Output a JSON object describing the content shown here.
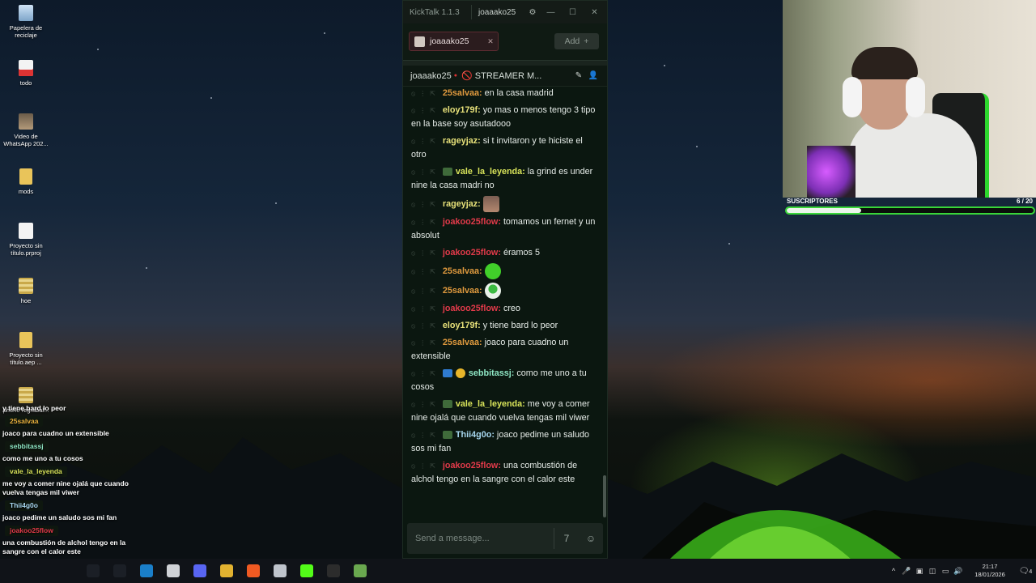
{
  "desktop": {
    "icons": [
      {
        "label": "Papelera de reciclaje",
        "icon": "recycle-bin-icon"
      },
      {
        "label": "todo",
        "icon": "document-icon"
      },
      {
        "label": "Video de WhatsApp 202...",
        "icon": "video-file-icon"
      },
      {
        "label": "mods",
        "icon": "folder-icon"
      },
      {
        "label": "Proyecto sin título.prproj",
        "icon": "document-icon"
      },
      {
        "label": "hoe",
        "icon": "archive-icon"
      },
      {
        "label": "Proyecto sin título.aep ...",
        "icon": "folder-icon"
      },
      {
        "label": "phone regrabal...",
        "icon": "archive-icon"
      }
    ]
  },
  "kicktalk": {
    "app_title": "KickTalk 1.1.3",
    "user": "joaaako25",
    "tab": {
      "label": "joaaako25",
      "close": "✕"
    },
    "add_label": "Add",
    "channel": {
      "name": "joaaako25",
      "title": "🚫 STREAMER M..."
    },
    "input_placeholder": "Send a message...",
    "messages": [
      {
        "user": "25salvaa",
        "color": "#e09a3e",
        "text": "en la casa madrid",
        "badge": ""
      },
      {
        "user": "eloy179f",
        "color": "#e8e27a",
        "text": "yo mas o menos tengo 3 tipo en la base soy asutadooo",
        "badge": ""
      },
      {
        "user": "rageyjaz",
        "color": "#e8e27a",
        "text": "si t invitaron y te hiciste el otro",
        "badge": ""
      },
      {
        "user": "vale_la_leyenda",
        "color": "#d9e45a",
        "text": "la grind es under nine la casa madri no",
        "badge": "frog"
      },
      {
        "user": "rageyjaz",
        "color": "#e8e27a",
        "text": "",
        "badge": "",
        "emote": "face"
      },
      {
        "user": "joakoo25flow",
        "color": "#e23a4a",
        "text": "tomamos un fernet y un absolut",
        "badge": ""
      },
      {
        "user": "joakoo25flow",
        "color": "#e23a4a",
        "text": "éramos 5",
        "badge": ""
      },
      {
        "user": "25salvaa",
        "color": "#e09a3e",
        "text": "",
        "badge": "",
        "emote": "green"
      },
      {
        "user": "25salvaa",
        "color": "#e09a3e",
        "text": "",
        "badge": "",
        "emote": "ghost"
      },
      {
        "user": "joakoo25flow",
        "color": "#e23a4a",
        "text": "creo",
        "badge": ""
      },
      {
        "user": "eloy179f",
        "color": "#e8e27a",
        "text": "y tiene bard lo peor",
        "badge": ""
      },
      {
        "user": "25salvaa",
        "color": "#e09a3e",
        "text": "joaco para cuadno un extensible",
        "badge": ""
      },
      {
        "user": "sebbitassj",
        "color": "#8ee6c4",
        "text": "como me uno a tu cosos",
        "badge": "mod-coin"
      },
      {
        "user": "vale_la_leyenda",
        "color": "#d9e45a",
        "text": "me voy a comer nine ojalá que cuando vuelva tengas mil viwer",
        "badge": "frog"
      },
      {
        "user": "Thii4g0o",
        "color": "#a8d8f0",
        "text": "joaco pedime un saludo sos mi fan",
        "badge": "frog"
      },
      {
        "user": "joakoo25flow",
        "color": "#e23a4a",
        "text": "una combustión de alchol tengo en la sangre con el calor este",
        "badge": ""
      }
    ]
  },
  "webcam": {
    "sub_label": "SUSCRIPTORES",
    "sub_count": "6 / 20",
    "sub_progress": 0.3
  },
  "overlay": {
    "lines": [
      {
        "type": "text",
        "value": "y tiene bard lo peor"
      },
      {
        "type": "name",
        "value": "25salvaa",
        "color": "#e8b03e"
      },
      {
        "type": "text",
        "value": "joaco para cuadno un extensible"
      },
      {
        "type": "name",
        "value": "sebbitassj",
        "color": "#8ee6c4"
      },
      {
        "type": "text",
        "value": "como me uno a tu cosos"
      },
      {
        "type": "name",
        "value": "vale_la_leyenda",
        "color": "#d9e45a"
      },
      {
        "type": "text",
        "value": "me voy a comer nine ojalá que cuando vuelva tengas mil viwer"
      },
      {
        "type": "name",
        "value": "Thii4g0o",
        "color": "#a8d8f0"
      },
      {
        "type": "text",
        "value": "joaco pedime un saludo sos mi fan"
      },
      {
        "type": "name",
        "value": "joakoo25flow",
        "color": "#e23a4a"
      },
      {
        "type": "text",
        "value": "una combustión de alchol tengo en la sangre con el calor este"
      }
    ]
  },
  "taskbar": {
    "apps": [
      {
        "name": "start-icon",
        "color": "#1b1f26"
      },
      {
        "name": "search-icon",
        "color": "#1b1f26"
      },
      {
        "name": "edge-icon",
        "color": "#1a7fc9"
      },
      {
        "name": "explorer-icon",
        "color": "#cfd2d6"
      },
      {
        "name": "discord-icon",
        "color": "#5865f2"
      },
      {
        "name": "chrome-icon",
        "color": "#e2b230"
      },
      {
        "name": "brave-icon",
        "color": "#f05a22"
      },
      {
        "name": "search-tool-icon",
        "color": "#bfc4cc"
      },
      {
        "name": "kick-icon",
        "color": "#53fc18"
      },
      {
        "name": "obs-icon",
        "color": "#2c2c2c"
      },
      {
        "name": "minecraft-icon",
        "color": "#6aa84f"
      }
    ],
    "time": "21:17",
    "date": "18/01/2026",
    "notifications": "4"
  }
}
